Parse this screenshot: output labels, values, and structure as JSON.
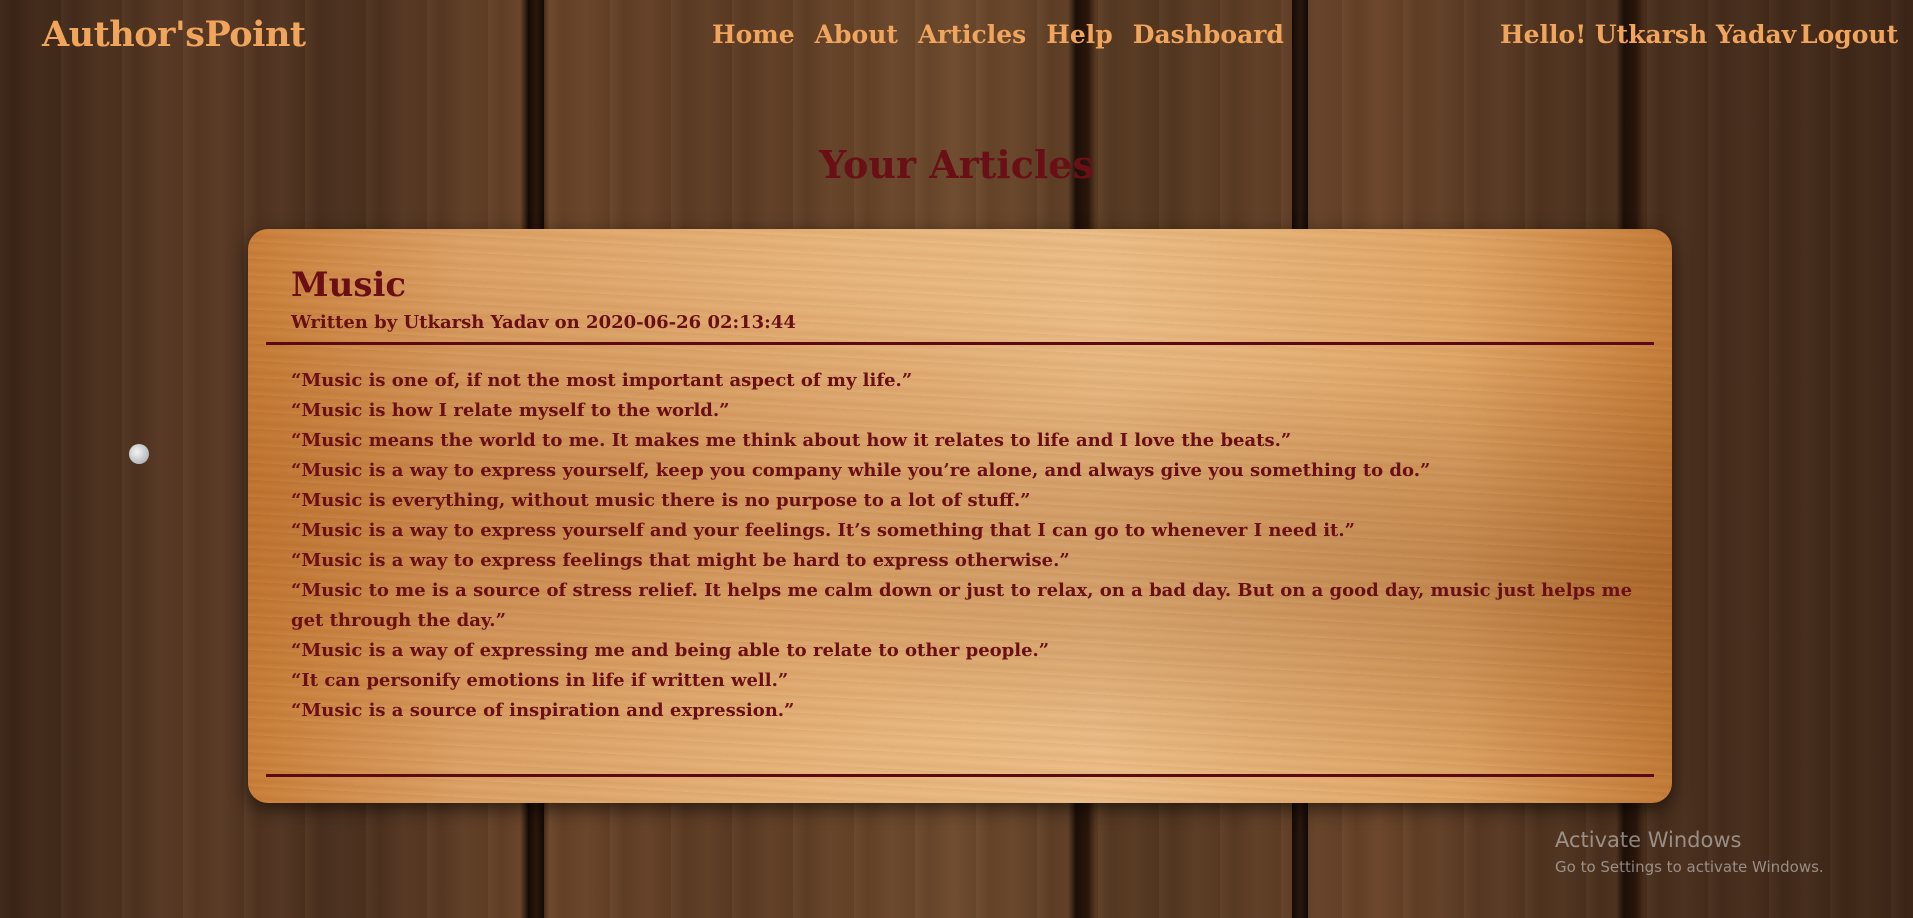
{
  "brand": "Author'sPoint",
  "nav": {
    "items": [
      "Home",
      "About",
      "Articles",
      "Help",
      "Dashboard"
    ]
  },
  "user": {
    "greeting": "Hello! Utkarsh Yadav",
    "logout": "Logout"
  },
  "page": {
    "title": "Your Articles"
  },
  "article": {
    "title": "Music",
    "byline": "Written by Utkarsh Yadav on 2020-06-26 02:13:44",
    "lines": [
      "“Music is one of, if not the most important aspect of my life.”",
      "“Music is how I relate myself to the world.”",
      "“Music means the world to me. It makes me think about how it relates to life and I love the beats.”",
      "“Music is a way to express yourself, keep you company while you’re alone, and always give you something to do.”",
      "“Music is everything, without music there is no purpose to a lot of stuff.”",
      "“Music is a way to express yourself and your feelings. It’s something that I can go to whenever I need it.”",
      "“Music is a way to express feelings that might be hard to express otherwise.”",
      "“Music to me is a source of stress relief. It helps me calm down or just to relax, on a bad day. But on a good day, music just helps me get through the day.”",
      "“Music is a way of expressing me and being able to relate to other people.”",
      "“It can personify emotions in life if written well.”",
      "“Music is a source of inspiration and expression.”"
    ]
  },
  "watermark": {
    "title": "Activate Windows",
    "subtitle": "Go to Settings to activate Windows."
  },
  "colors": {
    "accent": "#f0a45c",
    "text_dark": "#6a0f15"
  }
}
